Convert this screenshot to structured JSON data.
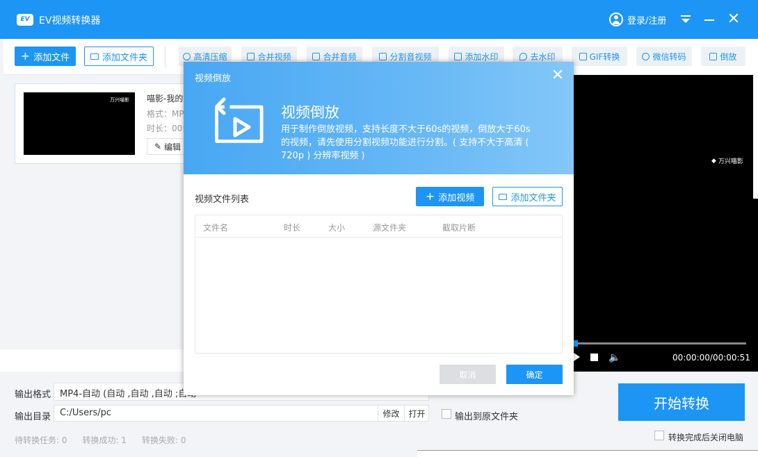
{
  "app": {
    "logo_text": "EV",
    "title": "EV视频转换器",
    "login": "登录/注册"
  },
  "toolbar": {
    "add_file": "添加文件",
    "add_folder": "添加文件夹",
    "tools": [
      "高清压缩",
      "合并视频",
      "合并音频",
      "分割音视频",
      "添加水印",
      "去水印",
      "GIF转换",
      "微信转码",
      "倒放"
    ]
  },
  "file_item": {
    "name": "喵影-我的",
    "format": "格式：MP",
    "duration": "时长：00:0",
    "edit": "编辑",
    "thumb_logo": "万兴喵影"
  },
  "preview": {
    "logo": "万兴喵影",
    "time": "00:00:00/00:00:51"
  },
  "output": {
    "format_label": "输出格式",
    "format_value": "MP4-自动 (自动 ,自动 ,自动 ;自动",
    "dir_label": "输出目录",
    "dir_value": "C:/Users/pc",
    "modify": "修改",
    "open": "打开",
    "to_source_folder": "输出到原文件夹"
  },
  "status": {
    "pending": "待转换任务: 0",
    "success": "转换成功: 1",
    "failed": "转换失败: 0"
  },
  "start_button": "开始转换",
  "shutdown_after": "转换完成后关闭电脑",
  "dialog": {
    "title": "视频倒放",
    "heading": "视频倒放",
    "description": "用于制作倒放视频，支持长度不大于60s的视频，倒放大于60s的视频，请先使用分割视频功能进行分割。( 支持不大于高清 ( 720p ) 分辨率视频 )",
    "list_label": "视频文件列表",
    "add_video": "添加视频",
    "add_folder": "添加文件夹",
    "columns": [
      "文件名",
      "时长",
      "大小",
      "源文件夹",
      "截取片断"
    ],
    "cancel": "取消",
    "ok": "确定"
  },
  "colors": {
    "accent": "#1d95f5",
    "header_gradient_start": "#48a7f3",
    "header_gradient_end": "#84c7f8",
    "disabled": "#dcdee2"
  }
}
